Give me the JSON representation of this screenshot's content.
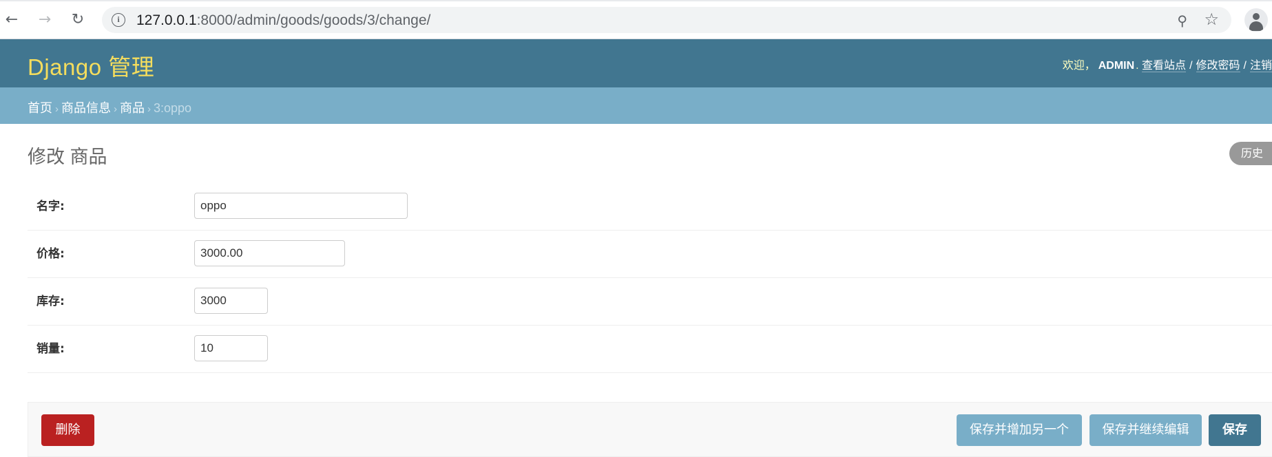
{
  "browser": {
    "url_host": "127.0.0.1",
    "url_path": ":8000/admin/goods/goods/3/change/"
  },
  "header": {
    "brand": "Django 管理",
    "welcome": "欢迎，",
    "username": "ADMIN",
    "period": ".",
    "view_site": "查看站点",
    "sep1": "/",
    "change_password": "修改密码",
    "sep2": "/",
    "logout": "注销"
  },
  "breadcrumbs": {
    "home": "首页",
    "app": "商品信息",
    "model": "商品",
    "current": "3:oppo",
    "separator": "›"
  },
  "page": {
    "title": "修改 商品",
    "history": "历史"
  },
  "form": {
    "fields": [
      {
        "label": "名字:",
        "value": "oppo"
      },
      {
        "label": "价格:",
        "value": "3000.00"
      },
      {
        "label": "库存:",
        "value": "3000"
      },
      {
        "label": "销量:",
        "value": "10"
      }
    ]
  },
  "actions": {
    "delete": "删除",
    "save_add_another": "保存并增加另一个",
    "save_continue": "保存并继续编辑",
    "save": "保存"
  },
  "colors": {
    "header_bg": "#417690",
    "brand": "#f5dd5d",
    "breadcrumbs_bg": "#79aec8",
    "delete_btn": "#ba2121",
    "save_btn": "#417690",
    "secondary_btn": "#79aec8"
  },
  "icons": [
    "back-arrow-icon",
    "forward-arrow-icon",
    "reload-icon",
    "info-icon",
    "zoom-out-icon",
    "star-icon",
    "profile-icon"
  ]
}
